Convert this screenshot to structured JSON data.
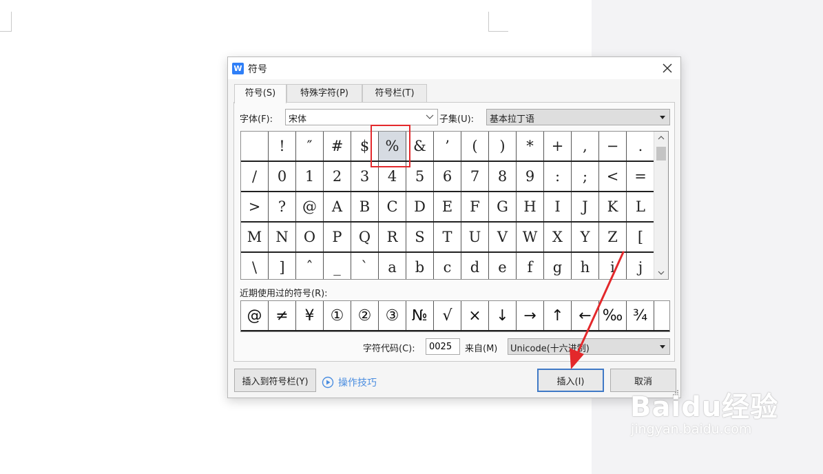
{
  "dialog": {
    "title": "符号",
    "tabs": [
      {
        "label": "符号(S)",
        "active": true
      },
      {
        "label": "特殊字符(P)",
        "active": false
      },
      {
        "label": "符号栏(T)",
        "active": false
      }
    ],
    "font_label": "字体(F):",
    "font_value": "宋体",
    "subset_label": "子集(U):",
    "subset_value": "基本拉丁语",
    "symbol_rows": [
      [
        "",
        "!",
        "″",
        "#",
        "$",
        "%",
        "&",
        "’",
        "(",
        ")",
        "*",
        "+",
        ",",
        "−",
        "."
      ],
      [
        "/",
        "0",
        "1",
        "2",
        "3",
        "4",
        "5",
        "6",
        "7",
        "8",
        "9",
        ":",
        ";",
        "<",
        "="
      ],
      [
        ">",
        "?",
        "@",
        "A",
        "B",
        "C",
        "D",
        "E",
        "F",
        "G",
        "H",
        "I",
        "J",
        "K",
        "L"
      ],
      [
        "M",
        "N",
        "O",
        "P",
        "Q",
        "R",
        "S",
        "T",
        "U",
        "V",
        "W",
        "X",
        "Y",
        "Z",
        "["
      ],
      [
        "\\",
        "]",
        "ˆ",
        "_",
        "`",
        "a",
        "b",
        "c",
        "d",
        "e",
        "f",
        "g",
        "h",
        "i",
        "j"
      ]
    ],
    "selected_symbol": "%",
    "recent_label": "近期使用过的符号(R):",
    "recent_symbols": [
      "@",
      "≠",
      "¥",
      "①",
      "②",
      "③",
      "№",
      "√",
      "×",
      "↓",
      "→",
      "↑",
      "←",
      "‰",
      "¾"
    ],
    "char_code_label": "字符代码(C):",
    "char_code_value": "0025",
    "from_label": "来自(M)",
    "from_value": "Unicode(十六进制)",
    "insert_to_bar_label": "插入到符号栏(Y)",
    "tips_label": "操作技巧",
    "insert_label": "插入(I)",
    "cancel_label": "取消"
  },
  "watermark": {
    "main": "Baidu经验",
    "sub": "jingyan.baidu.com"
  },
  "colors": {
    "annotation_red": "#e3282b",
    "primary_border": "#3f79c6",
    "tips_blue": "#4a8de0",
    "app_icon_blue": "#2f7ff7"
  }
}
